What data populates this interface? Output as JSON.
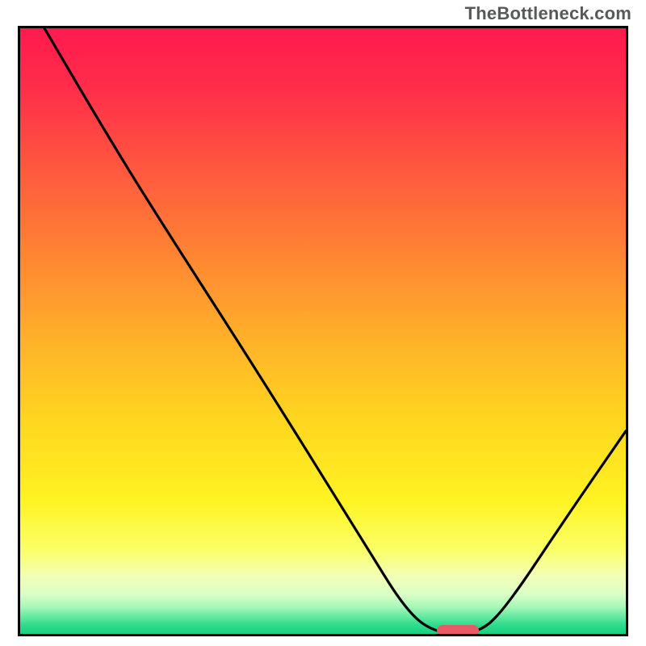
{
  "attribution": "TheBottleneck.com",
  "colors": {
    "border": "#000000",
    "curve": "#000000",
    "marker": "#e85b66",
    "gradient_stops": [
      {
        "offset": 0.0,
        "color": "#ff1a4e"
      },
      {
        "offset": 0.1,
        "color": "#ff2e4a"
      },
      {
        "offset": 0.22,
        "color": "#ff5440"
      },
      {
        "offset": 0.36,
        "color": "#ff8034"
      },
      {
        "offset": 0.5,
        "color": "#ffad2a"
      },
      {
        "offset": 0.64,
        "color": "#ffd420"
      },
      {
        "offset": 0.78,
        "color": "#fff322"
      },
      {
        "offset": 0.86,
        "color": "#fbff66"
      },
      {
        "offset": 0.905,
        "color": "#f2ffb6"
      },
      {
        "offset": 0.935,
        "color": "#d9ffc6"
      },
      {
        "offset": 0.955,
        "color": "#a8f7b8"
      },
      {
        "offset": 0.972,
        "color": "#63e9a0"
      },
      {
        "offset": 0.985,
        "color": "#2fdc8d"
      },
      {
        "offset": 1.0,
        "color": "#16d07f"
      }
    ]
  },
  "chart_data": {
    "type": "line",
    "title": "",
    "xlabel": "",
    "ylabel": "",
    "xlim": [
      0,
      100
    ],
    "ylim": [
      0,
      100
    ],
    "grid": false,
    "series": [
      {
        "name": "bottleneck-curve",
        "points": [
          {
            "x": 4.0,
            "y": 100.0
          },
          {
            "x": 14.0,
            "y": 83.0
          },
          {
            "x": 22.0,
            "y": 70.0
          },
          {
            "x": 40.0,
            "y": 42.0
          },
          {
            "x": 56.8,
            "y": 15.0
          },
          {
            "x": 64.0,
            "y": 3.4
          },
          {
            "x": 69.0,
            "y": 0.0
          },
          {
            "x": 75.5,
            "y": 0.0
          },
          {
            "x": 80.0,
            "y": 4.0
          },
          {
            "x": 90.0,
            "y": 19.0
          },
          {
            "x": 100.0,
            "y": 33.5
          }
        ]
      }
    ],
    "marker": {
      "x": 72.2,
      "y": 0.5,
      "label": "optimal-range"
    }
  }
}
